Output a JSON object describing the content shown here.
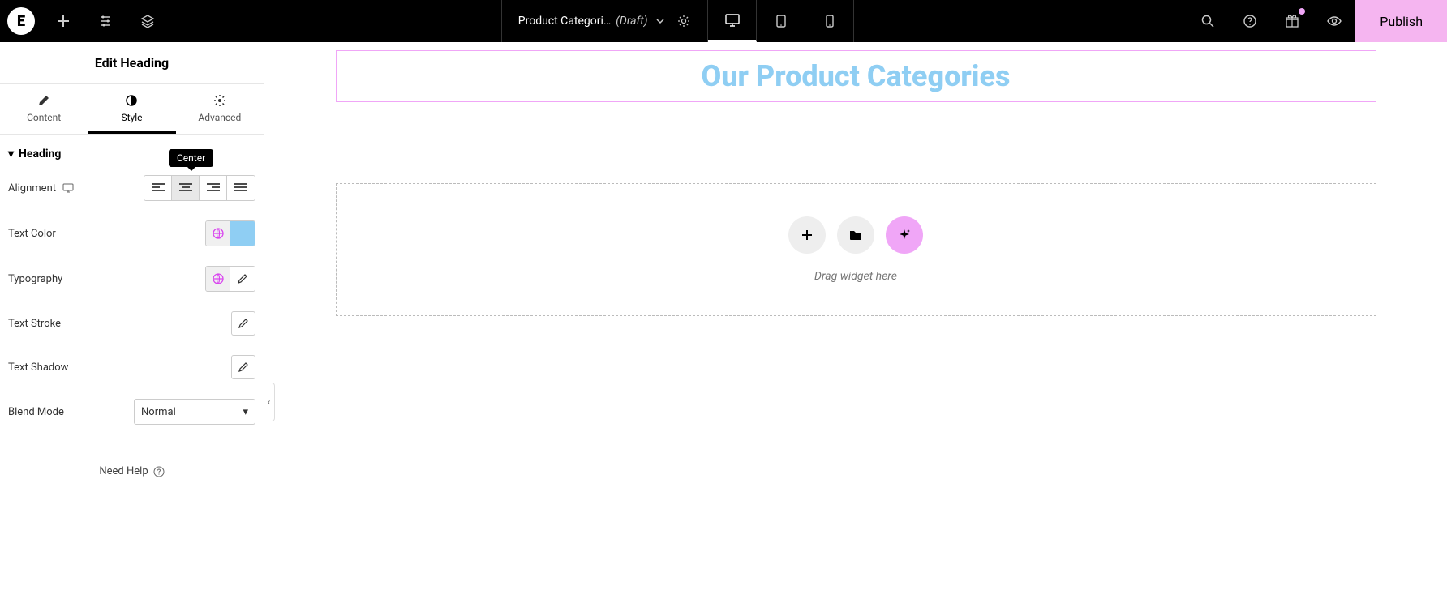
{
  "topbar": {
    "logo_letter": "E",
    "doc_title": "Product Categori…",
    "doc_status": "(Draft)",
    "publish_label": "Publish"
  },
  "sidebar": {
    "panel_title": "Edit Heading",
    "tabs": {
      "content": "Content",
      "style": "Style",
      "advanced": "Advanced"
    },
    "section_title": "Heading",
    "rows": {
      "alignment": "Alignment",
      "text_color": "Text Color",
      "typography": "Typography",
      "text_stroke": "Text Stroke",
      "text_shadow": "Text Shadow",
      "blend_mode": "Blend Mode"
    },
    "tooltip_center": "Center",
    "blend_value": "Normal",
    "help": "Need Help"
  },
  "canvas": {
    "heading_text": "Our Product Categories",
    "drop_text": "Drag widget here"
  },
  "colors": {
    "heading_color": "#8fcef3"
  }
}
